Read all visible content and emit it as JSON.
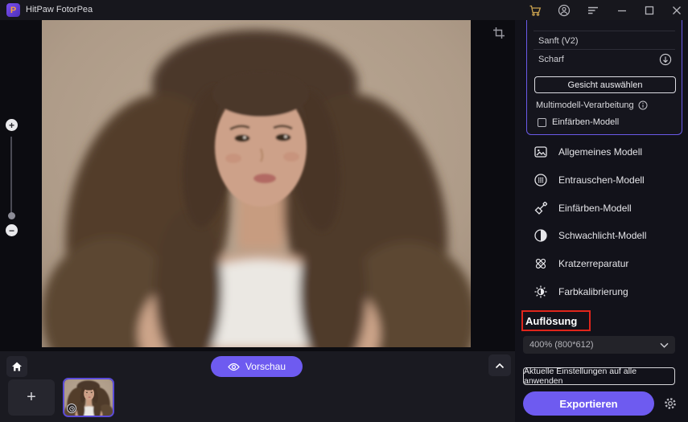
{
  "titlebar": {
    "title": "HitPaw FotorPea",
    "logo_letter": "P"
  },
  "canvas": {
    "zoom_in_label": "+",
    "zoom_out_label": "−"
  },
  "panel": {
    "option1": "Sanft (V2)",
    "option2": "Scharf",
    "select_face_button": "Gesicht auswählen",
    "multimodel_label": "Multimodell-Verarbeitung",
    "colorize_checkbox_label": "Einfärben-Modell",
    "colorize_checkbox_checked": false
  },
  "models": [
    {
      "label": "Allgemeines Modell",
      "icon": "general-model-icon"
    },
    {
      "label": "Entrauschen-Modell",
      "icon": "denoise-model-icon"
    },
    {
      "label": "Einfärben-Modell",
      "icon": "colorize-model-icon"
    },
    {
      "label": "Schwachlicht-Modell",
      "icon": "lowlight-model-icon"
    },
    {
      "label": "Kratzerreparatur",
      "icon": "scratch-repair-icon"
    },
    {
      "label": "Farbkalibrierung",
      "icon": "color-calibration-icon"
    }
  ],
  "resolution": {
    "label": "Auflösung",
    "value": "400% (800*612)"
  },
  "sidebar_footer": {
    "apply_all_button": "Aktuelle Einstellungen auf alle anwenden",
    "export_button": "Exportieren"
  },
  "bottom": {
    "preview_button": "Vorschau",
    "add_image_label": "+"
  },
  "colors": {
    "accent_purple": "#6e5bf0",
    "panel_border_purple": "#6a5ae8",
    "cart_gold": "#c9a14e",
    "annotation_red": "#e0251b",
    "background_dark": "#0c0c11",
    "sidebar_dark": "#12121a"
  },
  "icons": [
    "cart-icon",
    "account-icon",
    "menu-icon",
    "minimize-icon",
    "maximize-icon",
    "close-icon",
    "crop-icon",
    "home-icon",
    "eye-icon",
    "chevron-up-icon",
    "chevron-down-icon",
    "info-icon",
    "download-circle-icon",
    "gear-icon"
  ]
}
